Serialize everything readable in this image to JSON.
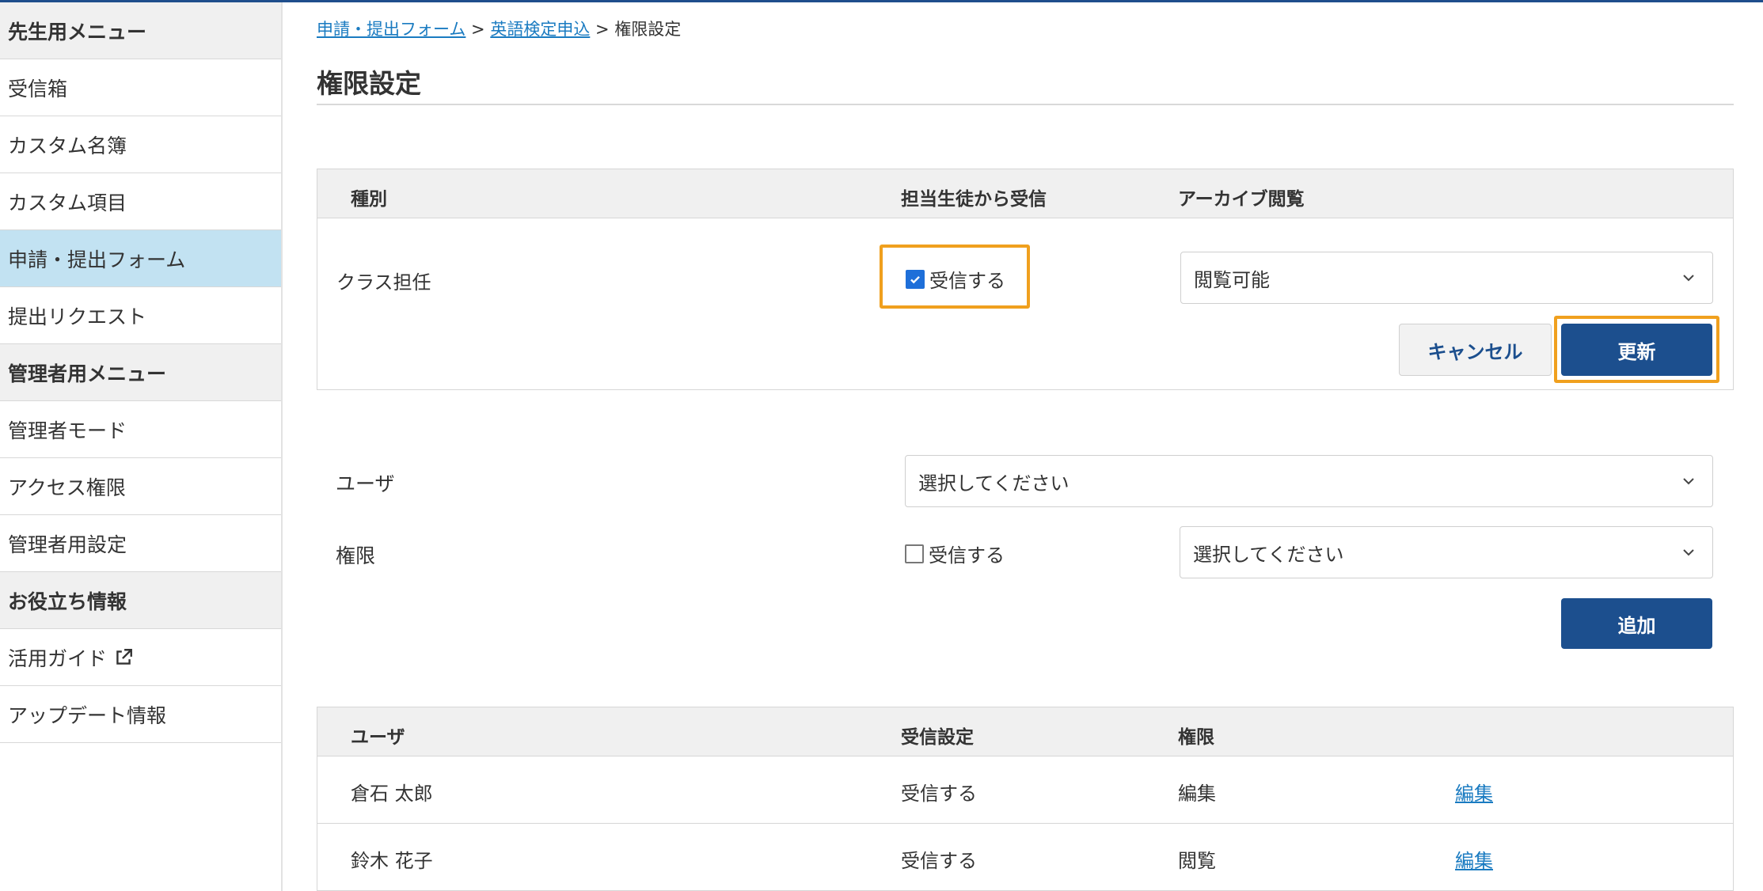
{
  "sidebar": {
    "items": [
      {
        "label": "先生用メニュー",
        "type": "header"
      },
      {
        "label": "受信箱",
        "type": "item"
      },
      {
        "label": "カスタム名簿",
        "type": "item"
      },
      {
        "label": "カスタム項目",
        "type": "item"
      },
      {
        "label": "申請・提出フォーム",
        "type": "item",
        "active": true
      },
      {
        "label": "提出リクエスト",
        "type": "item"
      },
      {
        "label": "管理者用メニュー",
        "type": "header"
      },
      {
        "label": "管理者モード",
        "type": "item"
      },
      {
        "label": "アクセス権限",
        "type": "item"
      },
      {
        "label": "管理者用設定",
        "type": "item"
      },
      {
        "label": "お役立ち情報",
        "type": "header"
      },
      {
        "label": "活用ガイド",
        "type": "item",
        "icon": "external-link-icon"
      },
      {
        "label": "アップデート情報",
        "type": "item"
      }
    ]
  },
  "breadcrumb": {
    "link1": "申請・提出フォーム",
    "sep1": " > ",
    "link2": "英語検定申込",
    "sep2": " > ",
    "current": "権限設定"
  },
  "page": {
    "title": "権限設定"
  },
  "role_table": {
    "headers": {
      "type": "種別",
      "receive": "担当生徒から受信",
      "archive": "アーカイブ閲覧"
    },
    "row": {
      "type": "クラス担任",
      "receive_label": "受信する",
      "receive_checked": true,
      "archive_value": "閲覧可能"
    },
    "cancel_label": "キャンセル",
    "update_label": "更新"
  },
  "add_form": {
    "user_label": "ユーザ",
    "user_placeholder": "選択してください",
    "perm_label": "権限",
    "receive_label": "受信する",
    "receive_checked": false,
    "perm_placeholder": "選択してください",
    "add_label": "追加"
  },
  "users_table": {
    "headers": {
      "user": "ユーザ",
      "receive": "受信設定",
      "permission": "権限"
    },
    "rows": [
      {
        "user": "倉石 太郎",
        "receive": "受信する",
        "permission": "編集",
        "action": "編集"
      },
      {
        "user": "鈴木 花子",
        "receive": "受信する",
        "permission": "閲覧",
        "action": "編集"
      }
    ]
  },
  "colors": {
    "accent": "#1c4f8e",
    "link": "#1a7bc1",
    "highlight": "#f0a01e",
    "active_menu": "#c2e2f2",
    "checkbox": "#1e6fd9"
  }
}
